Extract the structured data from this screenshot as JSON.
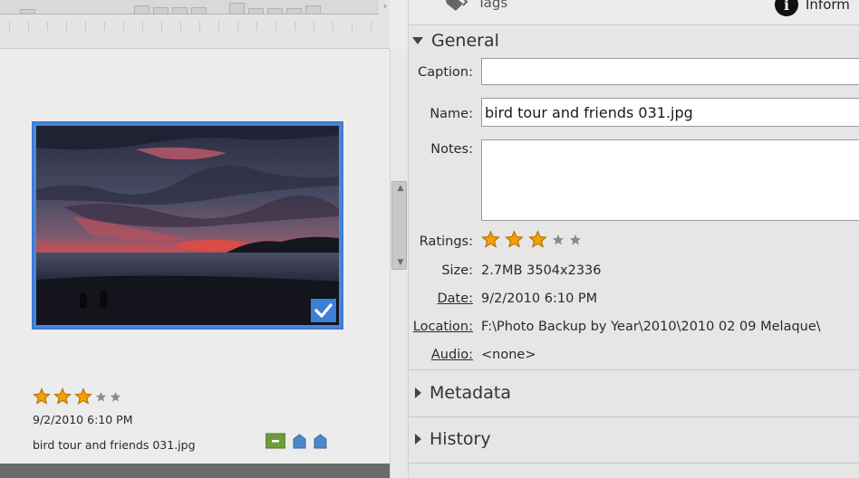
{
  "panel": {
    "tabs": [
      {
        "label": "Tags"
      },
      {
        "label": "Inform"
      }
    ],
    "general": {
      "title": "General",
      "caption_label": "Caption:",
      "caption_value": "",
      "name_label": "Name:",
      "name_value": "bird tour and friends 031.jpg",
      "notes_label": "Notes:",
      "notes_value": "",
      "ratings_label": "Ratings:",
      "rating": 3,
      "rating_max": 5,
      "size_label": "Size:",
      "size_value": "2.7MB  3504x2336",
      "date_label": "Date:",
      "date_value": "9/2/2010 6:10 PM",
      "location_label": "Location:",
      "location_value": "F:\\Photo Backup by Year\\2010\\2010 02 09 Melaque\\",
      "audio_label": "Audio:",
      "audio_value": "<none>"
    },
    "metadata": {
      "title": "Metadata"
    },
    "history": {
      "title": "History"
    }
  },
  "thumbnail": {
    "rating": 3,
    "rating_max": 5,
    "date": "9/2/2010 6:10 PM",
    "filename": "bird tour and friends 031.jpg",
    "selected": true
  },
  "colors": {
    "selection": "#3a7bd5",
    "star_filled": "#f2a100",
    "star_empty": "#8a8a8a"
  }
}
